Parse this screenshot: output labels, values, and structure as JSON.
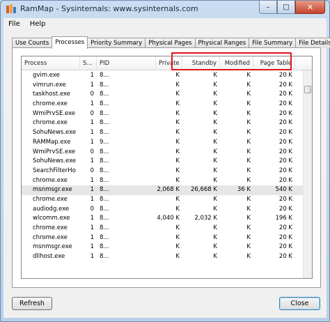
{
  "window": {
    "title": "RamMap - Sysinternals: www.sysinternals.com"
  },
  "window_buttons": {
    "minimize": "–",
    "maximize": "□",
    "close": "✕"
  },
  "menu": [
    "File",
    "Help"
  ],
  "tabs": [
    "Use Counts",
    "Processes",
    "Priority Summary",
    "Physical Pages",
    "Physical Ranges",
    "File Summary",
    "File Details"
  ],
  "active_tab": "Processes",
  "columns": [
    "Process",
    "S...",
    "PID",
    "Private",
    "Standby",
    "Modified",
    "Page Table"
  ],
  "rows": [
    [
      "gvim.exe",
      "1",
      "8...",
      "K",
      "K",
      "K",
      "20 K"
    ],
    [
      "vimrun.exe",
      "1",
      "8...",
      "K",
      "K",
      "K",
      "20 K"
    ],
    [
      "taskhost.exe",
      "0",
      "8...",
      "K",
      "K",
      "K",
      "20 K"
    ],
    [
      "chrome.exe",
      "1",
      "8...",
      "K",
      "K",
      "K",
      "20 K"
    ],
    [
      "WmiPrvSE.exe",
      "0",
      "8...",
      "K",
      "K",
      "K",
      "20 K"
    ],
    [
      "chrome.exe",
      "1",
      "8...",
      "K",
      "K",
      "K",
      "20 K"
    ],
    [
      "SohuNews.exe",
      "1",
      "8...",
      "K",
      "K",
      "K",
      "20 K"
    ],
    [
      "RAMMap.exe",
      "1",
      "9...",
      "K",
      "K",
      "K",
      "20 K"
    ],
    [
      "WmiPrvSE.exe",
      "0",
      "8...",
      "K",
      "K",
      "K",
      "20 K"
    ],
    [
      "SohuNews.exe",
      "1",
      "8...",
      "K",
      "K",
      "K",
      "20 K"
    ],
    [
      "SearchFilterHo",
      "0",
      "8...",
      "K",
      "K",
      "K",
      "20 K"
    ],
    [
      "chrome.exe",
      "1",
      "8...",
      "K",
      "K",
      "K",
      "20 K"
    ],
    [
      "msnmsgr.exe",
      "1",
      "8...",
      "2,068 K",
      "26,668 K",
      "36 K",
      "540 K"
    ],
    [
      "chrome.exe",
      "1",
      "8...",
      "K",
      "K",
      "K",
      "20 K"
    ],
    [
      "audiodg.exe",
      "0",
      "8...",
      "K",
      "K",
      "K",
      "20 K"
    ],
    [
      "wlcomm.exe",
      "1",
      "8...",
      "4,040 K",
      "2,032 K",
      "K",
      "196 K"
    ],
    [
      "chrome.exe",
      "1",
      "8...",
      "K",
      "K",
      "K",
      "20 K"
    ],
    [
      "chrome.exe",
      "1",
      "8...",
      "K",
      "K",
      "K",
      "20 K"
    ],
    [
      "msnmsgr.exe",
      "1",
      "8...",
      "K",
      "K",
      "K",
      "20 K"
    ],
    [
      "dllhost.exe",
      "1",
      "8...",
      "K",
      "K",
      "K",
      "20 K"
    ]
  ],
  "selected_row": 12,
  "buttons": {
    "refresh": "Refresh",
    "close": "Close"
  },
  "colors": {
    "highlight_box": "#e01616",
    "accent": "#3c7fb1"
  }
}
